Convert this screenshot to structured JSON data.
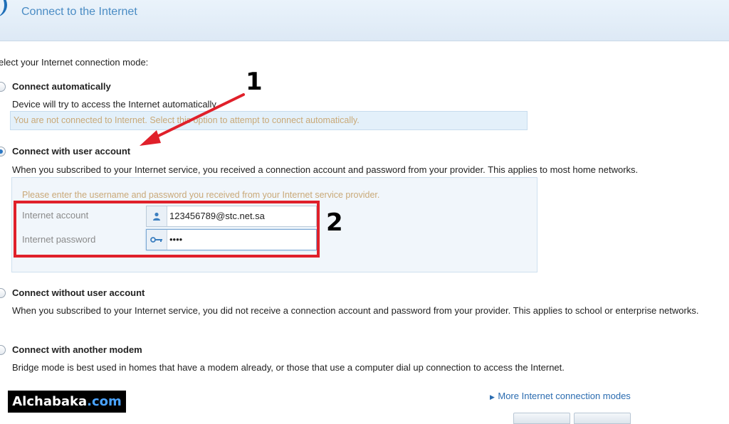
{
  "header": {
    "title": "Connect to the Internet"
  },
  "prompt_label": "elect your Internet connection mode:",
  "options": [
    {
      "title": "Connect automatically",
      "description": "Device will try to access the Internet automatically.",
      "status": "You are not connected to Internet. Select this option to attempt to connect automatically.",
      "selected": false
    },
    {
      "title": "Connect with user account",
      "description": "When you subscribed to your Internet service, you received a connection account and password from your provider. This applies to most home networks.",
      "selected": true
    },
    {
      "title": "Connect without user account",
      "description": "When you subscribed to your Internet service, you did not receive a connection account and password from your provider. This applies to school or enterprise networks.",
      "selected": false
    },
    {
      "title": "Connect with another modem",
      "description": "Bridge mode is best used in homes that have a modem already, or those that use a computer dial up connection to access the Internet.",
      "selected": false
    }
  ],
  "account": {
    "hint": "Please enter the username and password you received from your Internet service provider.",
    "account_label": "Internet account",
    "account_value": "123456789@stc.net.sa",
    "password_label": "Internet password",
    "password_value": "••••"
  },
  "annotations": {
    "step1": "1",
    "step2": "2"
  },
  "more_link": "More Internet connection modes",
  "brand": {
    "name": "Alchabaka",
    "domain": ".com"
  },
  "colors": {
    "annotation_red": "#e0202a",
    "accent_blue": "#2b78c4"
  }
}
